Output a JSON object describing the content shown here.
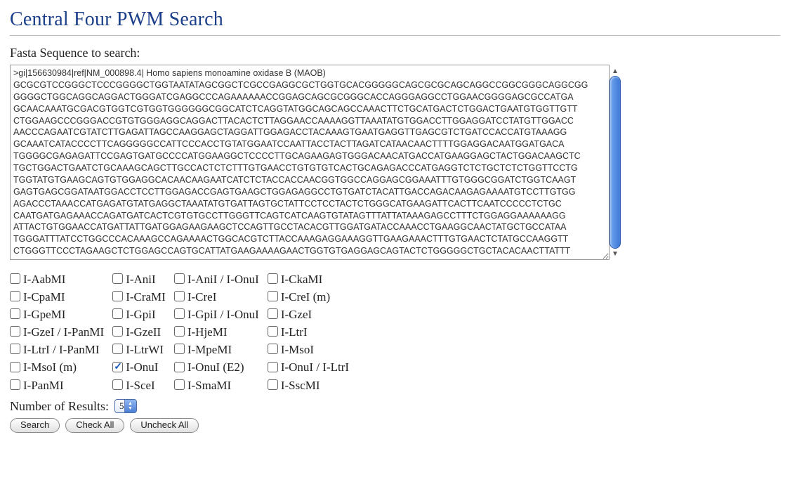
{
  "header": {
    "title": "Central Four PWM Search"
  },
  "form": {
    "fasta_label": "Fasta Sequence to search:",
    "fasta_text": ">gi|156630984|ref|NM_000898.4| Homo sapiens monoamine oxidase B (MAOB)\nGCGCGTCCGGGCTCCCGGGGCTGGTAATATAGCGGCTCGCCGAGGCGCTGGTGCACGGGGGCAGCGCGCAGCAGGCCGGCGGGCAGGCGG\nGGGGCTGGCAGGCAGGACTGGGATCGAGGCCCAGAAAAAACCGGAGCAGCGCGGGCACCAGGGAGGCCTGGAACGGGGAGCGCCATGA\nGCAACAAATGCGACGTGGTCGTGGTGGGGGGCGGCATCTCAGGTATGGCAGCAGCCAAACTTCTGCATGACTCTGGACTGAATGTGGTTGTT\nCTGGAAGCCCGGGACCGTGTGGGAGGCAGGACTTACACTCTTAGGAACCAAAAGGTTAAATATGTGGACCTTGGAGGATCCTATGTTGGACC\nAACCCAGAATCGTATCTTGAGATTAGCCAAGGAGCTAGGATTGGAGACCTACAAAGTGAATGAGGTTGAGCGTCTGATCCACCATGTAAAGG\nGCAAATCATACCCCTTCAGGGGGCCATTCCCACCTGTATGGAATCCAATTACCTACTTAGATCATAACAACTTTTGGAGGACAATGGATGACA\nTGGGGCGAGAGATTCCGAGTGATGCCCCATGGAAGGCTCCCCTTGCAGAAGAGTGGGACAACATGACCATGAAGGAGCTACTGGACAAGCTC\nTGCTGGACTGAATCTGCAAAGCAGCTTGCCACTCTCTTTGTGAACCTGTGTGTCACTGCAGAGACCCATGAGGTCTCTGCTCTCTGGTTCCTG\nTGGTATGTGAAGCAGTGTGGAGGCACAACAAGAATCATCTCTACCACCAACGGTGGCCAGGAGCGGAAATTTGTGGGCGGATCTGGTCAAGT\nGAGTGAGCGGATAATGGACCTCCTTGGAGACCGAGTGAAGCTGGAGAGGCCTGTGATCTACATTGACCAGACAAGAGAAAATGTCCTTGTGG\nAGACCCTAAACCATGAGATGTATGAGGCTAAATATGTGATTAGTGCTATTCCTCCTACTCTGGGCATGAAGATTCACTTCAATCCCCCTCTGC\nCAATGATGAGAAACCAGATGATCACTCGTGTGCCTTGGGTTCAGTCATCAAGTGTATAGTTTATTATAAAGAGCCTTTCTGGAGGAAAAAAGG\nATTACTGTGGAACCATGATTATTGATGGAGAAGAAGCTCCAGTTGCCTACACGTTGGATGATACCAAACCTGAAGGCAACTATGCTGCCATAA\nTGGGATTTATCCTGGCCCACAAAGCCAGAAAACTGGCACGTCTTACCAAAGAGGAAAGGTTGAAGAAACTTTGTGAACTCTATGCCAAGGTT\nCTGGGTTCCCTAGAAGCTCTGGAGCCAGTGCATTATGAAGAAAAGAACTGGTGTGAGGAGCAGTACTCTGGGGGCTGCTACACAACTTATTT\nCCCCCCTGGGATCCTGACTCAATATGGAAGGGTTCTACGCCAGCCAGTGGACAGGATTTACTTTGCAGGCACCGAGACTGCCACACACTGGA\nGCGGCTACATGGAGGGGGCTGTAGAGGCCGGGGAGAGCAGCCCGAGAGATCCTGCATGCCATGGGGAAGATTCCAGAGGATGAAATCTG\nGCAGTCAGAACCAGAGTCTGTGGATGTCCCTGCACAGCCCATCACCACCACCTTTTTGGAGAGACATTTGCCCTCCGTGCCAGGCCTGCTCA\nGGCTGATTGGATTGACCACCATCTTTTCAGCAACGGCTCTTGGCTTCCTGGCCCACAAAAGGGGGCTACTTGTGAGAGTCTAAAGAGAGAGG",
    "results_label": "Number of Results:",
    "results_value": "5",
    "buttons": {
      "search": "Search",
      "check_all": "Check All",
      "uncheck_all": "Uncheck All"
    }
  },
  "checkboxes": [
    [
      {
        "label": "I-AabMI",
        "checked": false
      },
      {
        "label": "I-AniI",
        "checked": false
      },
      {
        "label": "I-AniI / I-OnuI",
        "checked": false
      },
      {
        "label": "I-CkaMI",
        "checked": false
      }
    ],
    [
      {
        "label": "I-CpaMI",
        "checked": false
      },
      {
        "label": "I-CraMI",
        "checked": false
      },
      {
        "label": "I-CreI",
        "checked": false
      },
      {
        "label": "I-CreI (m)",
        "checked": false
      }
    ],
    [
      {
        "label": "I-GpeMI",
        "checked": false
      },
      {
        "label": "I-GpiI",
        "checked": false
      },
      {
        "label": "I-GpiI / I-OnuI",
        "checked": false
      },
      {
        "label": "I-GzeI",
        "checked": false
      }
    ],
    [
      {
        "label": "I-GzeI / I-PanMI",
        "checked": false
      },
      {
        "label": "I-GzeII",
        "checked": false
      },
      {
        "label": "I-HjeMI",
        "checked": false
      },
      {
        "label": "I-LtrI",
        "checked": false
      }
    ],
    [
      {
        "label": "I-LtrI / I-PanMI",
        "checked": false
      },
      {
        "label": "I-LtrWI",
        "checked": false
      },
      {
        "label": "I-MpeMI",
        "checked": false
      },
      {
        "label": "I-MsoI",
        "checked": false
      }
    ],
    [
      {
        "label": "I-MsoI (m)",
        "checked": false
      },
      {
        "label": "I-OnuI",
        "checked": true
      },
      {
        "label": "I-OnuI (E2)",
        "checked": false
      },
      {
        "label": "I-OnuI / I-LtrI",
        "checked": false
      }
    ],
    [
      {
        "label": "I-PanMI",
        "checked": false
      },
      {
        "label": "I-SceI",
        "checked": false
      },
      {
        "label": "I-SmaMI",
        "checked": false
      },
      {
        "label": "I-SscMI",
        "checked": false
      }
    ]
  ]
}
